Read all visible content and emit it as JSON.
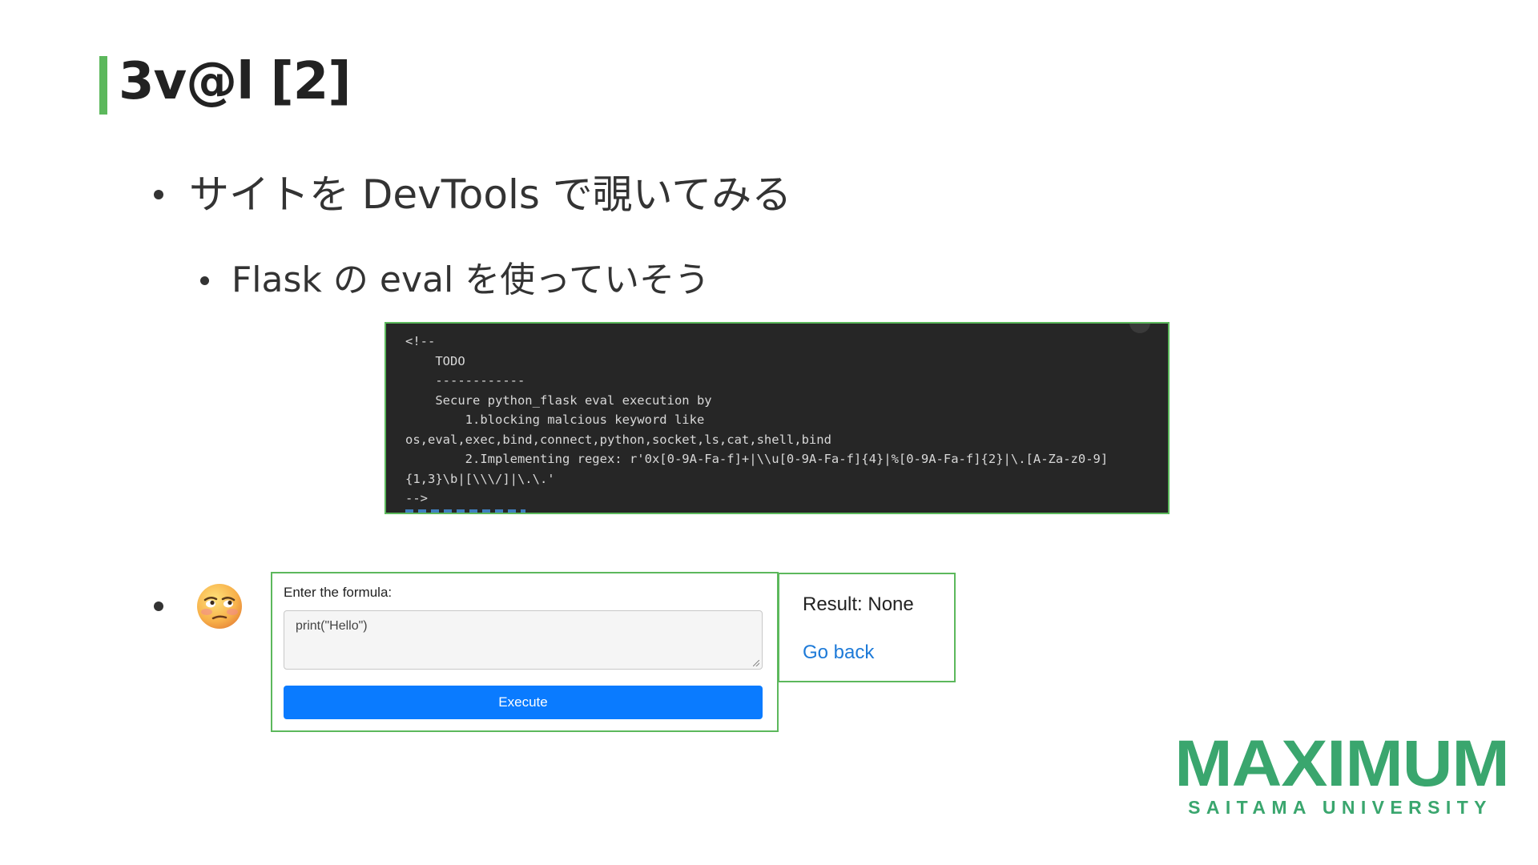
{
  "slide": {
    "title": "3v@l [2]",
    "bullet1": "サイトを DevTools で覗いてみる",
    "bullet2": "Flask の eval を使っていそう",
    "code": "<!--\n    TODO\n    ------------\n    Secure python_flask eval execution by\n        1.blocking malcious keyword like\nos,eval,exec,bind,connect,python,socket,ls,cat,shell,bind\n        2.Implementing regex: r'0x[0-9A-Fa-f]+|\\\\u[0-9A-Fa-f]{4}|%[0-9A-Fa-f]{2}|\\.[A-Za-z0-9]\n{1,3}\\b|[\\\\\\/]|\\.\\.'\n-->",
    "emoji_icon": "face-with-rolling-eyes-icon"
  },
  "form": {
    "label": "Enter the formula:",
    "input_value": "print(\"Hello\")",
    "button_label": "Execute"
  },
  "result": {
    "text": "Result: None",
    "link": "Go back"
  },
  "logo": {
    "main": "MAXIMUM",
    "sub": "SAITAMA UNIVERSITY"
  },
  "colors": {
    "accent_green": "#5cb85c",
    "logo_green": "#3aa66e",
    "button_blue": "#0a7bff",
    "link_blue": "#1d7ad8",
    "code_bg": "#262626"
  }
}
